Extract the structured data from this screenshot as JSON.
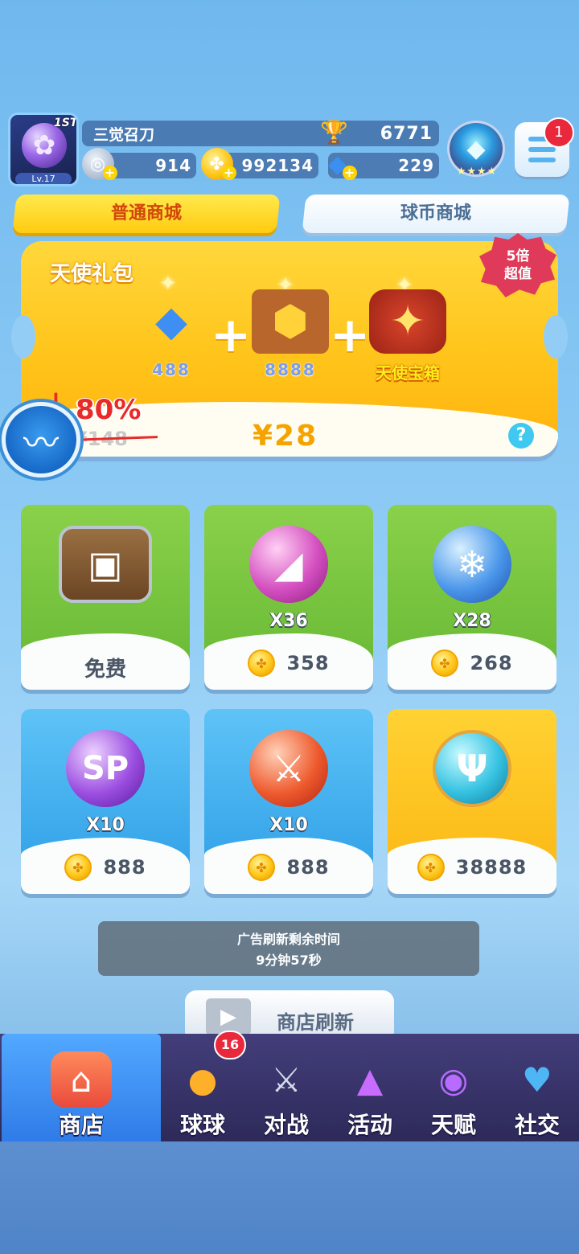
{
  "player": {
    "avatar_badge": "1ST",
    "level": "Lv.17",
    "name": "三觉召刀",
    "trophy_score": "6771",
    "currency_a": "914",
    "coins": "992134",
    "diamonds": "229"
  },
  "menu": {
    "notification_count": "1"
  },
  "tabs": [
    {
      "label": "普通商城",
      "active": true
    },
    {
      "label": "球币商城",
      "active": false
    }
  ],
  "angel_pack": {
    "title": "天使礼包",
    "badge_line1": "5倍",
    "badge_line2": "超值",
    "items": [
      {
        "label": "488",
        "icon": "diamond-pile"
      },
      {
        "label": "8888",
        "icon": "coin-chest"
      },
      {
        "label": "天使宝箱",
        "icon": "angel-chest"
      }
    ],
    "discount": "80%",
    "original_price": "¥148",
    "price": "¥28",
    "help": "?"
  },
  "shop_items": [
    {
      "qty": "",
      "price": "",
      "free_label": "免费",
      "icon": "treasure-chest",
      "color": "green"
    },
    {
      "qty": "X36",
      "price": "358",
      "free_label": "",
      "icon": "pink-ball",
      "color": "green"
    },
    {
      "qty": "X28",
      "price": "268",
      "free_label": "",
      "icon": "ice-ball",
      "color": "green"
    },
    {
      "qty": "X10",
      "price": "888",
      "free_label": "",
      "icon": "sp-ball",
      "color": "blue"
    },
    {
      "qty": "X10",
      "price": "888",
      "free_label": "",
      "icon": "sword-ball",
      "color": "blue"
    },
    {
      "qty": "",
      "price": "38888",
      "free_label": "",
      "icon": "trident-ball",
      "color": "gold"
    }
  ],
  "ad_refresh": {
    "line1": "广告刷新剩余时间",
    "line2": "9分钟57秒"
  },
  "refresh_button": {
    "label": "商店刷新"
  },
  "nav": {
    "items": [
      {
        "label": "商店",
        "active": true
      },
      {
        "label": "球球",
        "active": false
      },
      {
        "label": "对战",
        "active": false
      },
      {
        "label": "活动",
        "active": false
      },
      {
        "label": "天赋",
        "active": false
      },
      {
        "label": "社交",
        "active": false
      }
    ],
    "balls_badge": "16"
  },
  "colors": {
    "tab_active": "#ffcb10",
    "price_gold": "#f6a300",
    "discount_red": "#e82a2a",
    "nav_bg": "#2d2a5a"
  }
}
